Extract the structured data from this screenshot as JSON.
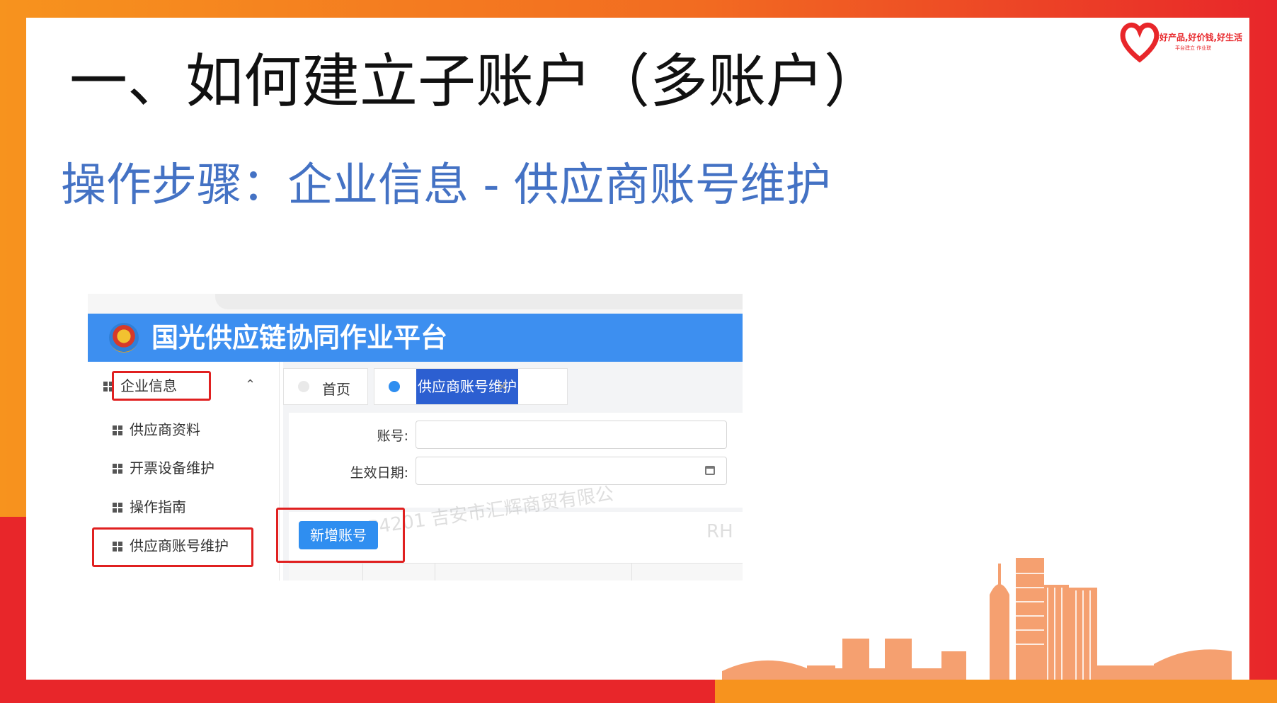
{
  "slide": {
    "title": "一、如何建立子账户（多账户）",
    "subtitle": "操作步骤：企业信息 - 供应商账号维护",
    "logo_text": "好产品,好价钱,好生活",
    "logo_sub": "平台建立 作业联"
  },
  "app": {
    "title": "国光供应链协同作业平台"
  },
  "sidebar": {
    "group_label": "企业信息",
    "items": [
      {
        "label": "供应商资料"
      },
      {
        "label": "开票设备维护"
      },
      {
        "label": "操作指南"
      },
      {
        "label": "供应商账号维护"
      }
    ]
  },
  "tabs": [
    {
      "label": "首页"
    },
    {
      "label": "供应商账号维护"
    }
  ],
  "form": {
    "account_label": "账号:",
    "date_label": "生效日期:"
  },
  "buttons": {
    "add_account": "新增账号"
  },
  "watermark": {
    "text": "P4201 吉安市汇辉商贸有限公",
    "text2": "RH"
  },
  "colors": {
    "accent_blue": "#3d8ff0",
    "highlight_red": "#e02020",
    "subtitle_blue": "#4472c4",
    "frame_orange": "#f7931e",
    "frame_red": "#e8262a"
  }
}
